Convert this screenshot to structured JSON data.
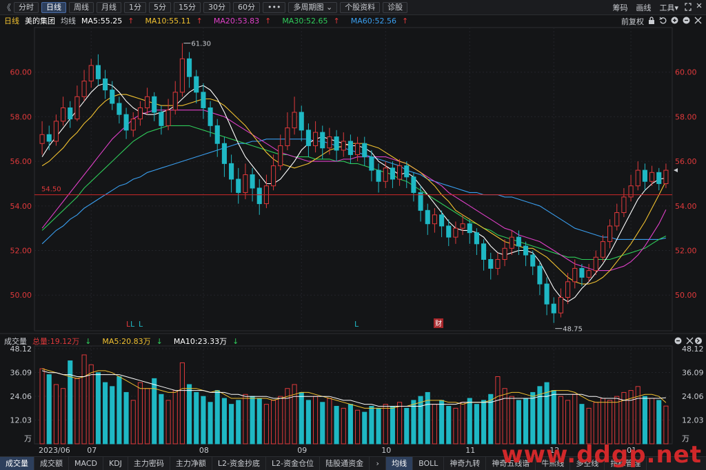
{
  "toolbar": {
    "back_glyph": "《",
    "buttons": [
      "分时",
      "日线",
      "周线",
      "月线",
      "1分",
      "5分",
      "15分",
      "30分",
      "60分",
      "•••",
      "多周期图",
      "个股资料",
      "诊股"
    ],
    "active": "日线",
    "multi_period_dropdown": "⌄",
    "right": [
      "筹码",
      "画线",
      "工具"
    ],
    "tools_caret": "▾"
  },
  "legend": {
    "period": "日线",
    "stock": "美的集团",
    "avg": "均线",
    "ma": [
      {
        "label": "MA5:55.25",
        "arrow": "↑",
        "color": "#ffffff"
      },
      {
        "label": "MA10:55.11",
        "arrow": "↑",
        "color": "#f2c230"
      },
      {
        "label": "MA20:53.83",
        "arrow": "↑",
        "color": "#e040c8"
      },
      {
        "label": "MA30:52.65",
        "arrow": "↑",
        "color": "#2fcc5a"
      },
      {
        "label": "MA60:52.56",
        "arrow": "↑",
        "color": "#3a9ff0"
      }
    ],
    "adjust": "前复权"
  },
  "volume_legend": {
    "title": "成交量",
    "total": "总量:19.12万",
    "ma5": "MA5:20.83万",
    "ma10": "MA10:23.33万",
    "arrow": "↓"
  },
  "colors": {
    "up": "#e0393b",
    "down": "#1fb8c4",
    "ma5": "#ffffff",
    "ma10": "#f2c230",
    "ma20": "#e040c8",
    "ma30": "#2fcc5a",
    "ma60": "#3a9ff0",
    "axis_text": "#e0393b"
  },
  "chart_data": [
    {
      "type": "candlestick",
      "y_ticks": [
        "60.00",
        "58.00",
        "56.00",
        "54.00",
        "52.00",
        "50.00"
      ],
      "ylim": [
        48.4,
        62.0
      ],
      "x_labels": [
        "2023/06",
        "07",
        "08",
        "09",
        "10",
        "11",
        "12",
        "01"
      ],
      "annotations": {
        "high": "61.30",
        "low": "48.75",
        "price_line": "54.50",
        "price_line_value": 54.5,
        "markers": [
          "L",
          "L",
          "L",
          "L",
          "财"
        ]
      },
      "candles": [
        [
          56.8,
          57.2,
          57.8,
          56.3
        ],
        [
          57.2,
          56.9,
          57.6,
          56.5
        ],
        [
          56.9,
          57.8,
          58.1,
          56.7
        ],
        [
          57.8,
          58.4,
          58.9,
          57.6
        ],
        [
          58.4,
          57.9,
          58.7,
          57.5
        ],
        [
          57.9,
          58.9,
          59.4,
          57.8
        ],
        [
          58.9,
          59.6,
          60.1,
          58.7
        ],
        [
          59.6,
          60.3,
          60.6,
          59.3
        ],
        [
          60.3,
          59.7,
          60.8,
          59.4
        ],
        [
          59.7,
          59.2,
          60.1,
          58.8
        ],
        [
          59.2,
          58.6,
          59.6,
          58.3
        ],
        [
          58.6,
          58.1,
          58.9,
          57.7
        ],
        [
          58.1,
          57.4,
          58.4,
          57.0
        ],
        [
          57.4,
          57.9,
          58.2,
          57.1
        ],
        [
          57.9,
          58.4,
          58.7,
          57.6
        ],
        [
          58.4,
          58.9,
          59.3,
          58.1
        ],
        [
          58.9,
          58.2,
          59.1,
          57.8
        ],
        [
          58.2,
          57.6,
          58.5,
          57.2
        ],
        [
          57.6,
          58.3,
          58.8,
          57.4
        ],
        [
          58.3,
          59.1,
          59.6,
          58.1
        ],
        [
          59.1,
          60.6,
          61.3,
          58.9
        ],
        [
          60.6,
          59.8,
          60.9,
          59.3
        ],
        [
          59.8,
          59.1,
          60.1,
          58.6
        ],
        [
          59.1,
          58.4,
          59.5,
          57.9
        ],
        [
          58.4,
          57.6,
          58.7,
          57.1
        ],
        [
          57.6,
          56.8,
          57.9,
          56.2
        ],
        [
          56.8,
          55.9,
          57.1,
          55.3
        ],
        [
          55.9,
          55.2,
          56.3,
          54.6
        ],
        [
          55.2,
          54.6,
          55.7,
          54.1
        ],
        [
          54.6,
          55.4,
          55.9,
          54.3
        ],
        [
          55.4,
          54.8,
          55.7,
          54.2
        ],
        [
          54.8,
          54.1,
          55.2,
          53.6
        ],
        [
          54.1,
          54.9,
          55.4,
          53.9
        ],
        [
          54.9,
          55.8,
          56.3,
          54.7
        ],
        [
          55.8,
          56.7,
          57.2,
          55.6
        ],
        [
          56.7,
          57.5,
          58.2,
          56.5
        ],
        [
          57.5,
          58.2,
          58.9,
          57.2
        ],
        [
          58.2,
          57.4,
          58.5,
          56.9
        ],
        [
          57.4,
          56.7,
          57.7,
          56.2
        ],
        [
          56.7,
          57.3,
          57.8,
          56.4
        ],
        [
          57.3,
          56.6,
          57.6,
          56.1
        ],
        [
          56.6,
          57.1,
          57.5,
          56.3
        ],
        [
          57.1,
          56.5,
          57.4,
          56.0
        ],
        [
          56.5,
          56.9,
          57.3,
          56.2
        ],
        [
          56.9,
          56.3,
          57.2,
          55.9
        ],
        [
          56.3,
          56.8,
          57.1,
          56.0
        ],
        [
          56.8,
          56.2,
          57.1,
          55.8
        ],
        [
          56.2,
          55.6,
          56.5,
          55.1
        ],
        [
          55.6,
          55.1,
          55.9,
          54.6
        ],
        [
          55.1,
          55.7,
          56.0,
          54.8
        ],
        [
          55.7,
          55.2,
          56.0,
          54.8
        ],
        [
          55.2,
          55.8,
          56.1,
          54.9
        ],
        [
          55.8,
          55.3,
          56.0,
          54.8
        ],
        [
          55.3,
          54.6,
          55.5,
          54.2
        ],
        [
          54.6,
          53.8,
          54.9,
          53.3
        ],
        [
          53.8,
          53.2,
          54.1,
          52.7
        ],
        [
          53.2,
          53.6,
          53.9,
          52.8
        ],
        [
          53.6,
          53.1,
          53.8,
          52.6
        ],
        [
          53.1,
          52.6,
          53.4,
          52.2
        ],
        [
          52.6,
          53.0,
          53.3,
          52.3
        ],
        [
          53.0,
          53.2,
          53.6,
          52.7
        ],
        [
          53.2,
          52.8,
          53.4,
          52.3
        ],
        [
          52.8,
          52.3,
          53.0,
          51.8
        ],
        [
          52.3,
          51.6,
          52.5,
          51.1
        ],
        [
          51.6,
          51.2,
          51.9,
          50.7
        ],
        [
          51.2,
          51.6,
          51.9,
          50.9
        ],
        [
          51.6,
          52.1,
          52.5,
          51.3
        ],
        [
          52.1,
          52.6,
          52.9,
          51.8
        ],
        [
          52.6,
          52.2,
          52.9,
          51.8
        ],
        [
          52.2,
          51.8,
          52.4,
          51.3
        ],
        [
          51.8,
          51.3,
          52.0,
          50.9
        ],
        [
          51.3,
          50.5,
          51.5,
          50.0
        ],
        [
          50.5,
          49.6,
          50.8,
          49.1
        ],
        [
          49.6,
          49.2,
          49.9,
          48.75
        ],
        [
          49.2,
          49.9,
          50.3,
          49.0
        ],
        [
          49.9,
          50.6,
          51.0,
          49.6
        ],
        [
          50.6,
          51.2,
          51.6,
          50.3
        ],
        [
          51.2,
          50.8,
          51.4,
          50.4
        ],
        [
          50.8,
          51.1,
          51.4,
          50.6
        ],
        [
          51.1,
          51.7,
          52.0,
          50.9
        ],
        [
          51.7,
          52.4,
          52.7,
          51.5
        ],
        [
          52.4,
          53.1,
          53.4,
          52.1
        ],
        [
          53.1,
          53.7,
          54.1,
          52.9
        ],
        [
          53.7,
          54.4,
          54.8,
          53.5
        ],
        [
          54.4,
          54.9,
          55.4,
          54.2
        ],
        [
          54.9,
          55.6,
          56.0,
          54.7
        ],
        [
          55.6,
          55.1,
          55.9,
          54.7
        ],
        [
          55.1,
          55.5,
          55.8,
          54.9
        ],
        [
          55.5,
          55.0,
          55.7,
          54.7
        ],
        [
          55.0,
          55.6,
          55.9,
          54.8
        ]
      ],
      "ma5": [
        56.2,
        56.7,
        57.1,
        57.5,
        57.9,
        58.3,
        58.7,
        59.1,
        59.4,
        59.5,
        59.4,
        59.1,
        58.7,
        58.4,
        58.2,
        58.1,
        58.1,
        58.2,
        58.3,
        58.5,
        58.8,
        59.1,
        59.3,
        59.4,
        59.2,
        58.8,
        58.2,
        57.5,
        56.8,
        56.2,
        55.8,
        55.4,
        55.0,
        55.0,
        55.2,
        55.6,
        56.0,
        56.5,
        56.8,
        57.0,
        57.1,
        57.0,
        56.9,
        56.8,
        56.7,
        56.7,
        56.6,
        56.4,
        56.0,
        55.8,
        55.6,
        55.4,
        55.5,
        55.3,
        54.9,
        54.5,
        54.1,
        53.7,
        53.3,
        53.0,
        52.9,
        52.9,
        52.8,
        52.6,
        52.2,
        51.9,
        51.8,
        51.9,
        52.0,
        52.0,
        51.9,
        51.5,
        50.9,
        50.3,
        49.9,
        49.7,
        49.9,
        50.3,
        50.6,
        51.0,
        51.4,
        51.9,
        52.5,
        53.1,
        53.7,
        54.3,
        54.7,
        55.0,
        55.2,
        55.25
      ],
      "ma10": [
        55.8,
        56.0,
        56.3,
        56.6,
        57.0,
        57.3,
        57.7,
        58.0,
        58.4,
        58.7,
        58.9,
        59.0,
        59.0,
        58.9,
        58.8,
        58.7,
        58.6,
        58.5,
        58.5,
        58.5,
        58.5,
        58.6,
        58.7,
        58.8,
        58.8,
        58.7,
        58.5,
        58.2,
        57.9,
        57.6,
        57.2,
        56.8,
        56.4,
        56.1,
        55.9,
        55.8,
        55.7,
        55.8,
        55.9,
        56.1,
        56.3,
        56.5,
        56.6,
        56.7,
        56.8,
        56.8,
        56.8,
        56.7,
        56.6,
        56.4,
        56.2,
        56.0,
        55.9,
        55.7,
        55.5,
        55.2,
        54.9,
        54.5,
        54.2,
        53.8,
        53.6,
        53.4,
        53.2,
        53.0,
        52.8,
        52.6,
        52.4,
        52.3,
        52.2,
        52.1,
        52.1,
        51.9,
        51.7,
        51.4,
        51.1,
        50.8,
        50.6,
        50.5,
        50.5,
        50.6,
        50.8,
        51.1,
        51.5,
        51.9,
        52.3,
        52.8,
        53.3,
        53.9,
        54.5,
        55.11
      ],
      "ma20": [
        53.0,
        53.4,
        53.8,
        54.2,
        54.6,
        55.0,
        55.4,
        55.8,
        56.2,
        56.6,
        57.0,
        57.3,
        57.6,
        57.9,
        58.1,
        58.2,
        58.3,
        58.3,
        58.3,
        58.3,
        58.3,
        58.3,
        58.3,
        58.3,
        58.2,
        58.1,
        58.0,
        57.8,
        57.6,
        57.4,
        57.2,
        57.0,
        56.8,
        56.6,
        56.4,
        56.3,
        56.2,
        56.1,
        56.0,
        56.0,
        56.0,
        56.0,
        56.0,
        56.1,
        56.1,
        56.2,
        56.2,
        56.2,
        56.2,
        56.2,
        56.1,
        56.0,
        55.9,
        55.7,
        55.5,
        55.3,
        55.1,
        54.9,
        54.6,
        54.4,
        54.2,
        54.0,
        53.8,
        53.6,
        53.4,
        53.2,
        53.0,
        52.9,
        52.7,
        52.6,
        52.5,
        52.4,
        52.2,
        52.0,
        51.8,
        51.6,
        51.4,
        51.3,
        51.2,
        51.1,
        51.1,
        51.1,
        51.2,
        51.3,
        51.5,
        51.8,
        52.2,
        52.7,
        53.2,
        53.83
      ],
      "ma30": [
        52.9,
        53.2,
        53.5,
        53.8,
        54.1,
        54.4,
        54.8,
        55.1,
        55.4,
        55.7,
        56.0,
        56.3,
        56.6,
        56.9,
        57.1,
        57.3,
        57.4,
        57.5,
        57.6,
        57.6,
        57.6,
        57.6,
        57.5,
        57.4,
        57.3,
        57.2,
        57.1,
        57.0,
        56.9,
        56.8,
        56.7,
        56.6,
        56.5,
        56.4,
        56.3,
        56.3,
        56.2,
        56.2,
        56.2,
        56.1,
        56.1,
        56.1,
        56.0,
        56.0,
        55.9,
        55.9,
        55.8,
        55.7,
        55.6,
        55.5,
        55.4,
        55.2,
        55.1,
        54.9,
        54.7,
        54.5,
        54.3,
        54.1,
        53.9,
        53.7,
        53.5,
        53.3,
        53.2,
        53.0,
        52.9,
        52.7,
        52.6,
        52.5,
        52.4,
        52.3,
        52.2,
        52.1,
        52.0,
        51.9,
        51.8,
        51.7,
        51.7,
        51.6,
        51.6,
        51.6,
        51.6,
        51.6,
        51.7,
        51.8,
        51.9,
        52.0,
        52.1,
        52.3,
        52.5,
        52.65
      ],
      "ma60": [
        52.3,
        52.6,
        52.9,
        53.1,
        53.4,
        53.6,
        53.9,
        54.1,
        54.3,
        54.5,
        54.7,
        54.9,
        55.0,
        55.2,
        55.3,
        55.5,
        55.6,
        55.7,
        55.8,
        55.9,
        56.0,
        56.1,
        56.2,
        56.3,
        56.4,
        56.5,
        56.6,
        56.7,
        56.8,
        56.8,
        56.9,
        56.9,
        57.0,
        57.0,
        57.0,
        57.0,
        57.0,
        57.0,
        57.0,
        56.9,
        56.9,
        56.8,
        56.7,
        56.6,
        56.5,
        56.4,
        56.3,
        56.2,
        56.1,
        56.0,
        55.9,
        55.8,
        55.6,
        55.5,
        55.4,
        55.2,
        55.1,
        55.0,
        54.9,
        54.8,
        54.7,
        54.6,
        54.6,
        54.5,
        54.5,
        54.5,
        54.4,
        54.4,
        54.3,
        54.2,
        54.1,
        54.0,
        53.8,
        53.6,
        53.4,
        53.2,
        53.0,
        52.9,
        52.8,
        52.7,
        52.6,
        52.6,
        52.5,
        52.5,
        52.5,
        52.5,
        52.5,
        52.5,
        52.5,
        52.56
      ]
    },
    {
      "type": "bar",
      "series_name": "成交量",
      "unit": "万",
      "y_ticks": [
        "48.12",
        "36.09",
        "24.06",
        "12.03"
      ],
      "ylim": [
        0,
        48.12
      ],
      "values": [
        38,
        35,
        30,
        28,
        42,
        33,
        45,
        40,
        36,
        31,
        29,
        34,
        26,
        22,
        31,
        28,
        33,
        25,
        22,
        27,
        41,
        30,
        26,
        24,
        21,
        27,
        23,
        20,
        22,
        25,
        24,
        23,
        20,
        22,
        24,
        28,
        30,
        26,
        22,
        24,
        21,
        23,
        19,
        18,
        20,
        17,
        16,
        19,
        18,
        20,
        19,
        21,
        18,
        22,
        24,
        26,
        20,
        22,
        19,
        18,
        21,
        23,
        20,
        22,
        25,
        34,
        28,
        24,
        22,
        23,
        26,
        29,
        31,
        27,
        24,
        22,
        25,
        20,
        18,
        21,
        23,
        22,
        24,
        26,
        27,
        29,
        24,
        23,
        22,
        19.12
      ],
      "ma5": [
        38,
        37,
        36,
        35,
        34,
        33,
        34,
        36,
        37,
        37,
        36,
        34,
        32,
        30,
        28,
        28,
        28,
        27,
        26,
        26,
        28,
        28,
        28,
        27,
        26,
        27,
        25,
        23,
        23,
        23,
        23,
        23,
        23,
        22,
        23,
        24,
        25,
        26,
        26,
        25,
        24,
        23,
        22,
        21,
        20,
        19,
        18,
        18,
        18,
        18,
        18,
        19,
        19,
        20,
        21,
        22,
        22,
        22,
        21,
        21,
        20,
        21,
        21,
        21,
        22,
        24,
        25,
        26,
        26,
        25,
        24,
        25,
        26,
        27,
        27,
        27,
        26,
        24,
        22,
        21,
        21,
        21,
        21,
        22,
        23,
        24,
        25,
        25,
        24,
        20.83
      ],
      "ma10": [
        37,
        36,
        36,
        35,
        35,
        34,
        34,
        35,
        35,
        35,
        35,
        35,
        34,
        33,
        32,
        31,
        30,
        29,
        28,
        27,
        27,
        27,
        27,
        27,
        26,
        26,
        26,
        25,
        25,
        24,
        24,
        24,
        24,
        23,
        23,
        23,
        24,
        24,
        24,
        24,
        24,
        24,
        23,
        22,
        22,
        21,
        20,
        20,
        19,
        19,
        19,
        19,
        19,
        19,
        19,
        20,
        20,
        20,
        20,
        20,
        21,
        21,
        21,
        21,
        21,
        22,
        23,
        23,
        23,
        23,
        23,
        24,
        24,
        25,
        25,
        25,
        25,
        25,
        24,
        24,
        23,
        23,
        23,
        22,
        22,
        23,
        23,
        23,
        23,
        23.33
      ]
    }
  ],
  "tabs": {
    "left": [
      "成交量",
      "成交额",
      "MACD",
      "KDJ",
      "主力密码",
      "主力净额",
      "L2-资金抄底",
      "L2-资金仓位",
      "陆股通资金"
    ],
    "right": [
      "均线",
      "BOLL",
      "神奇九转",
      "神奇五线谱",
      "牛熊线",
      "多空线",
      "指标管理"
    ],
    "active_left": "成交量",
    "active_right": "均线",
    "arrow": "›"
  },
  "watermark": "www.ddgp.net"
}
